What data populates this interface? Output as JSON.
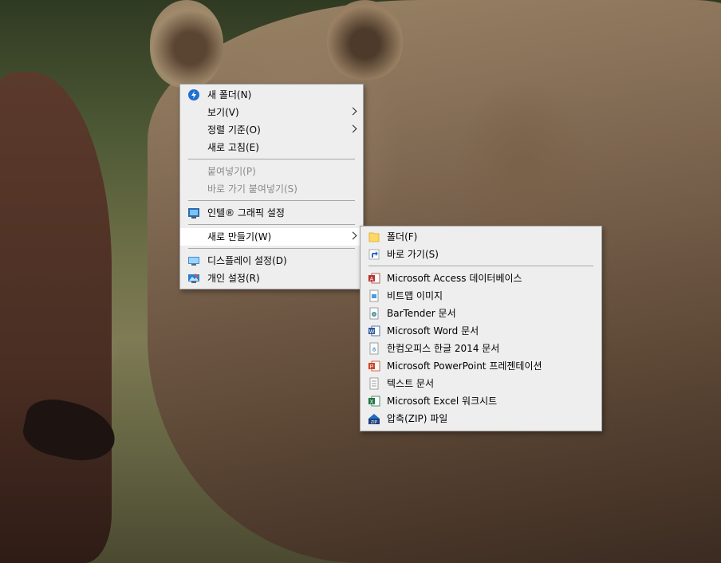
{
  "main_menu": {
    "items": [
      {
        "label": "새 폴더(N)",
        "icon": "new-folder-blue-icon"
      },
      {
        "label": "보기(V)"
      },
      {
        "label": "정렬 기준(O)"
      },
      {
        "label": "새로 고침(E)"
      },
      {
        "label": "붙여넣기(P)"
      },
      {
        "label": "바로 가기 붙여넣기(S)"
      },
      {
        "label": "인텔® 그래픽 설정",
        "icon": "intel-graphics-icon"
      },
      {
        "label": "새로 만들기(W)"
      },
      {
        "label": "디스플레이 설정(D)",
        "icon": "display-icon"
      },
      {
        "label": "개인 설정(R)",
        "icon": "personalize-icon"
      }
    ]
  },
  "new_submenu": {
    "items": [
      {
        "label": "폴더(F)",
        "icon": "folder-icon"
      },
      {
        "label": "바로 가기(S)",
        "icon": "shortcut-icon"
      },
      {
        "label": "Microsoft Access 데이터베이스",
        "icon": "access-icon"
      },
      {
        "label": "비트맵 이미지",
        "icon": "bitmap-icon"
      },
      {
        "label": "BarTender 문서",
        "icon": "bartender-icon"
      },
      {
        "label": "Microsoft Word 문서",
        "icon": "word-icon"
      },
      {
        "label": "한컴오피스 한글 2014 문서",
        "icon": "hwp-icon"
      },
      {
        "label": "Microsoft PowerPoint 프레젠테이션",
        "icon": "powerpoint-icon"
      },
      {
        "label": "텍스트 문서",
        "icon": "text-icon"
      },
      {
        "label": "Microsoft Excel 워크시트",
        "icon": "excel-icon"
      },
      {
        "label": "압축(ZIP) 파일",
        "icon": "zip-icon"
      }
    ]
  },
  "colors": {
    "menu_bg": "#eeeeee",
    "menu_border": "#a0a0a0",
    "hover_bg": "#ffffff",
    "disabled_text": "#8a8a8a"
  }
}
